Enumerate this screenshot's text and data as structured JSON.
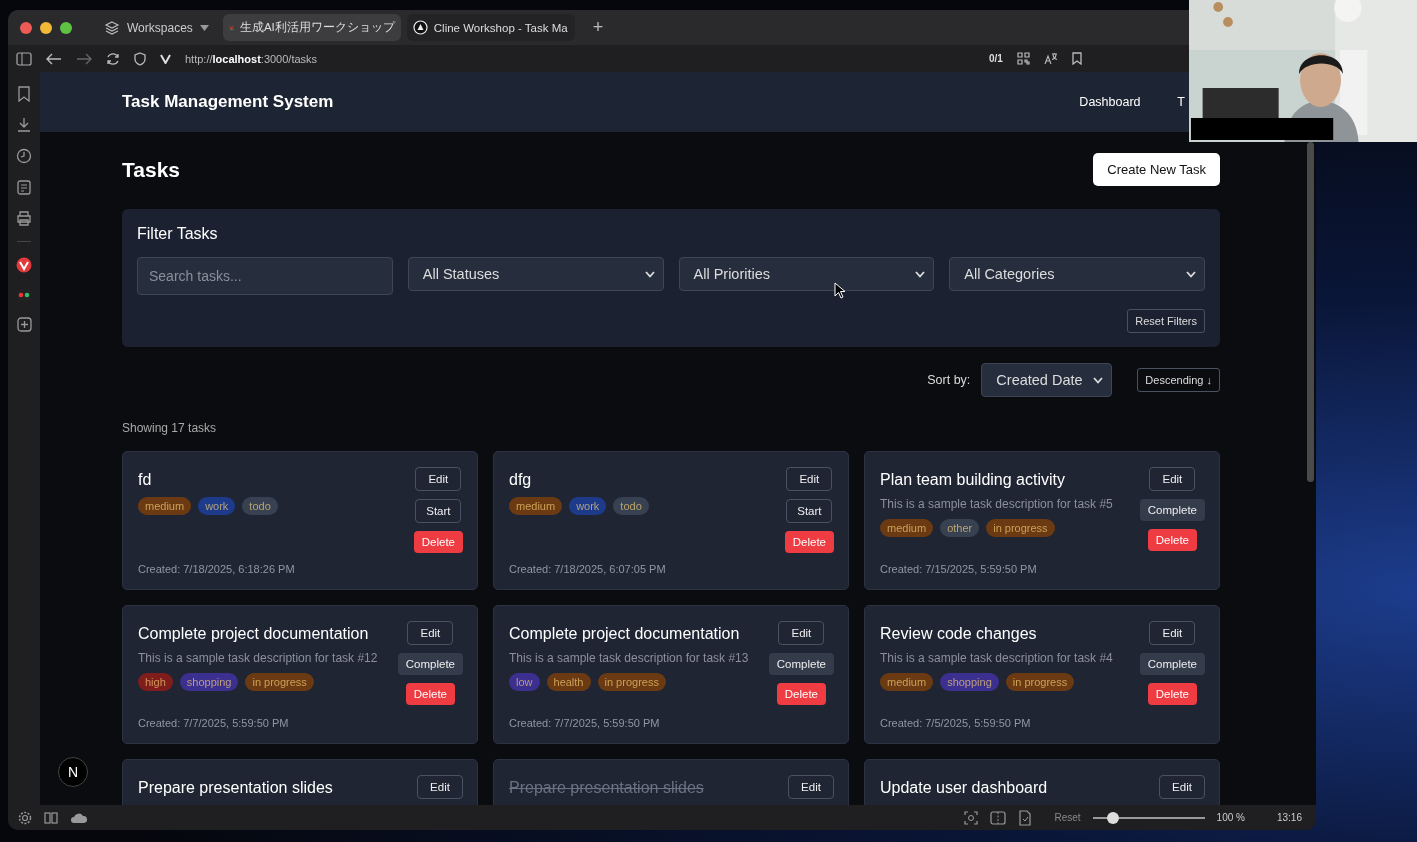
{
  "browser": {
    "workspaces": "Workspaces",
    "tabs": [
      {
        "title": "生成AI利活用ワークショップ",
        "selected": true
      },
      {
        "title": "Cline Workshop - Task Ma",
        "selected": false
      }
    ],
    "new_tab": "+",
    "url": "http://**localhost**:3000/tasks",
    "page_count": "0/1"
  },
  "header": {
    "title": "Task Management System",
    "nav": [
      "Dashboard",
      "T"
    ]
  },
  "page": {
    "title": "Tasks",
    "create_button": "Create New Task"
  },
  "filters": {
    "title": "Filter Tasks",
    "search": {
      "placeholder": "Search tasks..."
    },
    "selects": [
      "All Statuses",
      "All Priorities",
      "All Categories"
    ],
    "reset_button": "Reset Filters"
  },
  "sort": {
    "label": "Sort by:",
    "value": "Created Date",
    "order_button": "Descending ↓"
  },
  "count": "Showing 17 tasks",
  "tasks": [
    {
      "title": "fd",
      "completed": false,
      "tags": [
        {
          "label": "medium",
          "color": "#6b3a12"
        },
        {
          "label": "work",
          "color": "#1e3a8a"
        },
        {
          "label": "todo",
          "color": "#374151"
        }
      ],
      "created": "Created: 7/18/2025, 6:18:26 PM",
      "actions": [
        {
          "label": "Edit",
          "kind": "edit"
        },
        {
          "label": "Start",
          "kind": "start"
        },
        {
          "label": "Delete",
          "kind": "delete"
        }
      ]
    },
    {
      "title": "dfg",
      "completed": false,
      "tags": [
        {
          "label": "medium",
          "color": "#6b3a12"
        },
        {
          "label": "work",
          "color": "#1e3a8a"
        },
        {
          "label": "todo",
          "color": "#374151"
        }
      ],
      "created": "Created: 7/18/2025, 6:07:05 PM",
      "actions": [
        {
          "label": "Edit",
          "kind": "edit"
        },
        {
          "label": "Start",
          "kind": "start"
        },
        {
          "label": "Delete",
          "kind": "delete"
        }
      ]
    },
    {
      "title": "Plan team building activity",
      "completed": false,
      "description": "This is a sample task description for task #5",
      "tags": [
        {
          "label": "medium",
          "color": "#6b3a12"
        },
        {
          "label": "other",
          "color": "#374151"
        },
        {
          "label": "in progress",
          "color": "#6b3a12"
        }
      ],
      "created": "Created: 7/15/2025, 5:59:50 PM",
      "actions": [
        {
          "label": "Edit",
          "kind": "edit"
        },
        {
          "label": "Complete",
          "kind": "complete"
        },
        {
          "label": "Delete",
          "kind": "delete"
        }
      ]
    },
    {
      "title": "Complete project documentation",
      "completed": false,
      "description": "This is a sample task description for task #12",
      "tags": [
        {
          "label": "high",
          "color": "#7f1d1d"
        },
        {
          "label": "shopping",
          "color": "#3b2f8f"
        },
        {
          "label": "in progress",
          "color": "#6b3a12"
        }
      ],
      "created": "Created: 7/7/2025, 5:59:50 PM",
      "actions": [
        {
          "label": "Edit",
          "kind": "edit"
        },
        {
          "label": "Complete",
          "kind": "complete"
        },
        {
          "label": "Delete",
          "kind": "delete"
        }
      ]
    },
    {
      "title": "Complete project documentation",
      "completed": false,
      "description": "This is a sample task description for task #13",
      "tags": [
        {
          "label": "low",
          "color": "#3b2f8f"
        },
        {
          "label": "health",
          "color": "#6b3a12"
        },
        {
          "label": "in progress",
          "color": "#6b3a12"
        }
      ],
      "created": "Created: 7/7/2025, 5:59:50 PM",
      "actions": [
        {
          "label": "Edit",
          "kind": "edit"
        },
        {
          "label": "Complete",
          "kind": "complete"
        },
        {
          "label": "Delete",
          "kind": "delete"
        }
      ]
    },
    {
      "title": "Review code changes",
      "completed": false,
      "description": "This is a sample task description for task #4",
      "tags": [
        {
          "label": "medium",
          "color": "#6b3a12"
        },
        {
          "label": "shopping",
          "color": "#3b2f8f"
        },
        {
          "label": "in progress",
          "color": "#6b3a12"
        }
      ],
      "created": "Created: 7/5/2025, 5:59:50 PM",
      "actions": [
        {
          "label": "Edit",
          "kind": "edit"
        },
        {
          "label": "Complete",
          "kind": "complete"
        },
        {
          "label": "Delete",
          "kind": "delete"
        }
      ]
    },
    {
      "title": "Prepare presentation slides",
      "completed": false,
      "actions": [
        {
          "label": "Edit",
          "kind": "edit"
        }
      ]
    },
    {
      "title": "Prepare presentation slides",
      "completed": true,
      "actions": [
        {
          "label": "Edit",
          "kind": "edit"
        }
      ]
    },
    {
      "title": "Update user dashboard",
      "completed": false,
      "actions": [
        {
          "label": "Edit",
          "kind": "edit"
        }
      ]
    }
  ],
  "dev_badge": "N",
  "status_bar": {
    "reset": "Reset",
    "zoom": {
      "level": 0.18
    },
    "zoom_reading": "100 %",
    "clock": "13:16"
  }
}
